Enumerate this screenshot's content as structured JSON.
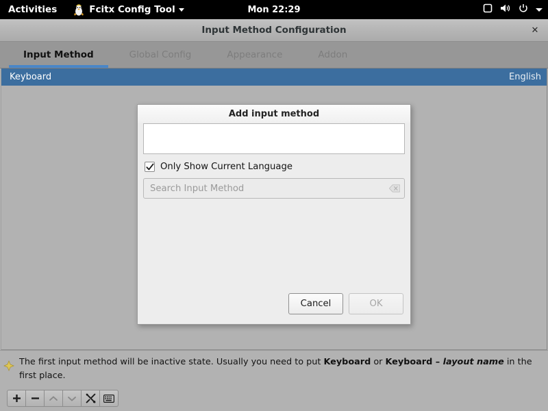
{
  "topbar": {
    "activities_label": "Activities",
    "app_menu_label": "Fcitx Config Tool",
    "app_icon": "fcitx-penguin-icon",
    "clock": "Mon 22:29",
    "tray_icons": [
      "screen-icon",
      "volume-icon",
      "power-icon",
      "chevron-down-icon"
    ]
  },
  "window": {
    "title": "Input Method Configuration",
    "close_label": "✕",
    "tabs": [
      {
        "label": "Input Method",
        "active": true
      },
      {
        "label": "Global Config",
        "active": false
      },
      {
        "label": "Appearance",
        "active": false
      },
      {
        "label": "Addon",
        "active": false
      }
    ],
    "input_methods": [
      {
        "name": "Keyboard",
        "language": "English",
        "selected": true
      }
    ],
    "hint": {
      "icon": "info-diamond-icon",
      "part1": "The first input method will be inactive state. Usually you need to put ",
      "bold1": "Keyboard",
      "part2": " or ",
      "bold2": "Keyboard – ",
      "italic1": "layout name",
      "part3": " in the first place."
    },
    "toolbar": [
      {
        "name": "add-input-method-button",
        "icon": "plus-icon",
        "glyph": "＋",
        "disabled": false
      },
      {
        "name": "remove-input-method-button",
        "icon": "minus-icon",
        "glyph": "−",
        "disabled": false
      },
      {
        "name": "move-up-button",
        "icon": "chevron-up-icon",
        "glyph": "⌃",
        "disabled": true
      },
      {
        "name": "move-down-button",
        "icon": "chevron-down-icon",
        "glyph": "⌄",
        "disabled": true
      },
      {
        "name": "configure-button",
        "icon": "tools-icon",
        "glyph": "⚒",
        "disabled": false
      },
      {
        "name": "keyboard-layout-button",
        "icon": "keyboard-icon",
        "glyph": "⌨",
        "disabled": false
      }
    ]
  },
  "dialog": {
    "title": "Add input method",
    "checkbox": {
      "label": "Only Show Current Language",
      "checked": true
    },
    "search": {
      "placeholder": "Search Input Method",
      "value": "",
      "clear_icon": "clear-backspace-icon"
    },
    "language_list_items": [],
    "result_list_items": [],
    "buttons": {
      "cancel": {
        "label": "Cancel",
        "disabled": false
      },
      "ok": {
        "label": "OK",
        "disabled": true
      }
    }
  },
  "colors": {
    "desktop_grey": "#b2b2b2",
    "tabbar_grey": "#979797",
    "selection_blue": "#3c6e9f",
    "tab_underline_blue": "#4a86c8",
    "dialog_bg": "#ededed",
    "topbar_black": "#000000",
    "hint_icon_gold": "#d8c24a"
  }
}
